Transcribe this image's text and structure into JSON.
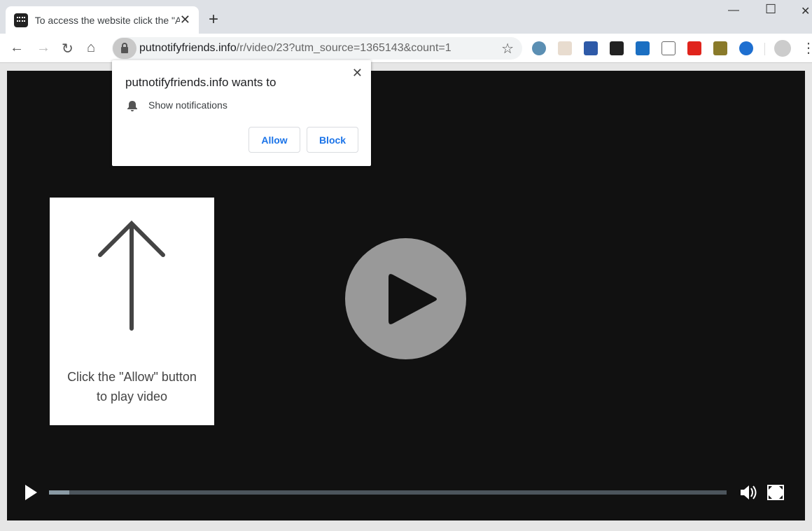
{
  "tab": {
    "title": "To access the website click the \"Allow\""
  },
  "address": {
    "domain": "putnotifyfriends.info",
    "path": "/r/video/23?utm_source=1365143&count=1"
  },
  "extensions": [
    {
      "name": "magnifier-extension-icon",
      "color": "#5b8fb3"
    },
    {
      "name": "y-extension-icon",
      "color": "#e8dccf"
    },
    {
      "name": "tree-extension-icon",
      "color": "#2e5aa8"
    },
    {
      "name": "s-extension-icon",
      "color": "#222222"
    },
    {
      "name": "pdf-extension-icon",
      "color": "#1b6fc2"
    },
    {
      "name": "document-extension-icon",
      "color": "#ffffff"
    },
    {
      "name": "popcorn-extension-icon",
      "color": "#e0241c"
    },
    {
      "name": "cc-extension-icon",
      "color": "#8a7a2a"
    },
    {
      "name": "search-extension-icon",
      "color": "#1e6fd0"
    }
  ],
  "popup": {
    "title": "putnotifyfriends.info wants to",
    "permission": "Show notifications",
    "allow": "Allow",
    "block": "Block"
  },
  "card": {
    "line1": "Click the \"Allow\" button",
    "line2": "to play video"
  },
  "video": {
    "progress_percent": 3
  },
  "colors": {
    "accent": "#1a73e8",
    "video_bg": "#111111"
  }
}
